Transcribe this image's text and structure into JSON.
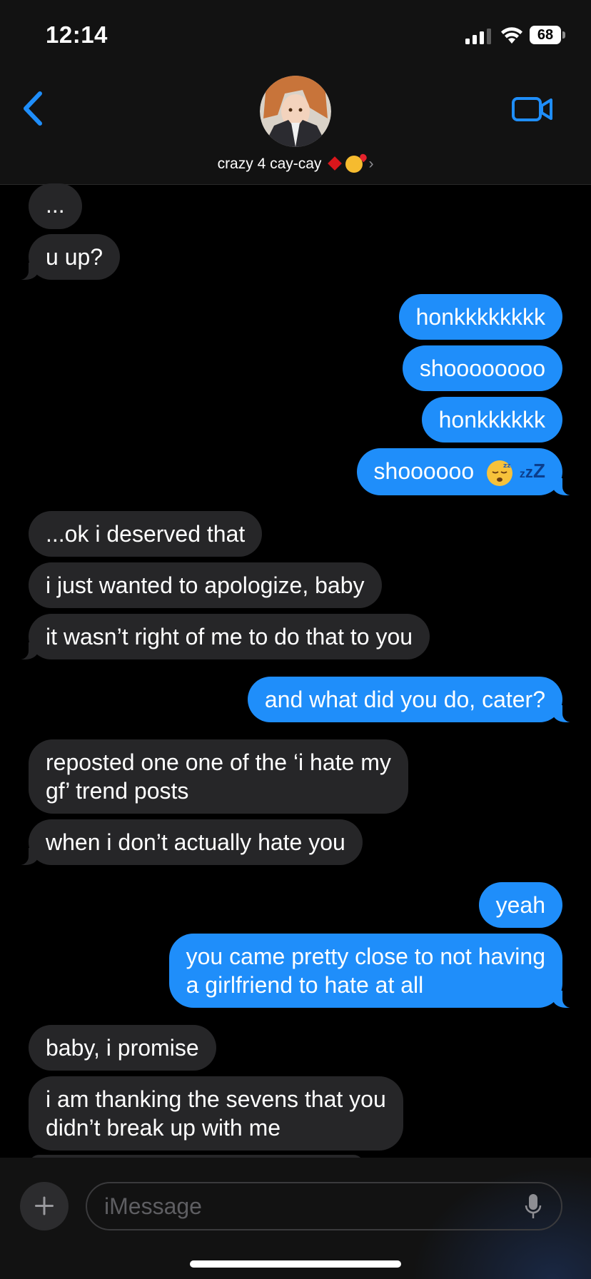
{
  "status_bar": {
    "time": "12:14",
    "battery": "68"
  },
  "header": {
    "contact_name": "crazy 4 cay-cay"
  },
  "messages": [
    {
      "side": "in",
      "text": "..."
    },
    {
      "side": "in",
      "text": "u up?"
    },
    {
      "side": "out",
      "text": "honkkkkkkkk"
    },
    {
      "side": "out",
      "text": "shoooooooo"
    },
    {
      "side": "out",
      "text": "honkkkkkk"
    },
    {
      "side": "out",
      "text": "shoooooo"
    },
    {
      "side": "in",
      "text": "...ok i deserved that"
    },
    {
      "side": "in",
      "text": "i just wanted to apologize, baby"
    },
    {
      "side": "in",
      "text": "it wasn’t right of me to do that to you"
    },
    {
      "side": "out",
      "text": "and what did you do, cater?"
    },
    {
      "side": "in",
      "line1": "reposted one one of the ‘i hate my",
      "line2": "gf’ trend posts"
    },
    {
      "side": "in",
      "text": "when i don’t actually hate you"
    },
    {
      "side": "out",
      "text": "yeah"
    },
    {
      "side": "out",
      "line1": "you came pretty close to not having",
      "line2": "a girlfriend to hate at all"
    },
    {
      "side": "in",
      "text": "baby, i promise"
    },
    {
      "side": "in",
      "line1": "i am thanking the sevens that you",
      "line2": "didn’t break up with me"
    }
  ],
  "composer": {
    "placeholder": "iMessage"
  },
  "icons": {
    "back": "chevron-left-icon",
    "video": "video-camera-icon",
    "plus": "plus-icon",
    "mic": "microphone-icon",
    "emoji": "sleepy-face-icon"
  },
  "colors": {
    "outgoing_bubble": "#1f8efa",
    "incoming_bubble": "#262628",
    "accent": "#1f8efa",
    "background": "#000000"
  }
}
